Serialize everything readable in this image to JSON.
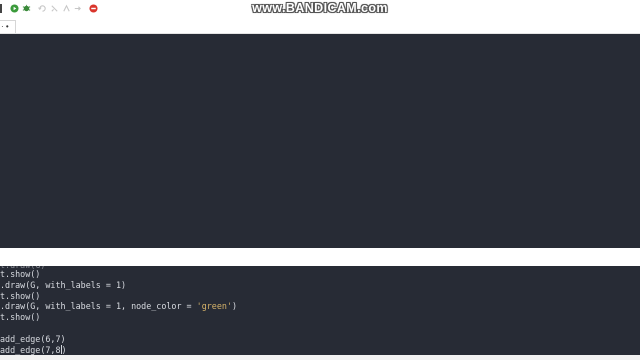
{
  "watermark": "www.BANDICAM.com",
  "toolbar": {
    "icons": [
      "run-icon",
      "debug-icon",
      "undo-icon",
      "redo-icon",
      "step-icon",
      "step-over-icon",
      "stop-icon"
    ]
  },
  "tab": {
    "label": "· •"
  },
  "editor": {
    "lines": [
      {
        "text": "t.show()"
      },
      {
        "text": ".draw(G, with_labels = 1)"
      },
      {
        "text": "t.show()"
      },
      {
        "text": ".draw(G, with_labels = 1, node_color = ",
        "str": "'green'",
        "tail": ")"
      },
      {
        "text": "t.show()"
      },
      {
        "text": ""
      },
      {
        "text": "add_edge(6,7)"
      },
      {
        "text": "add_edge(7,8",
        "tail": ")"
      }
    ]
  },
  "colors": {
    "pane_background": "#272b35",
    "code_text": "#d7dae0",
    "string_literal": "#d6b36a",
    "run_button": "#3a9a3a",
    "stop_button": "#d9342b"
  }
}
